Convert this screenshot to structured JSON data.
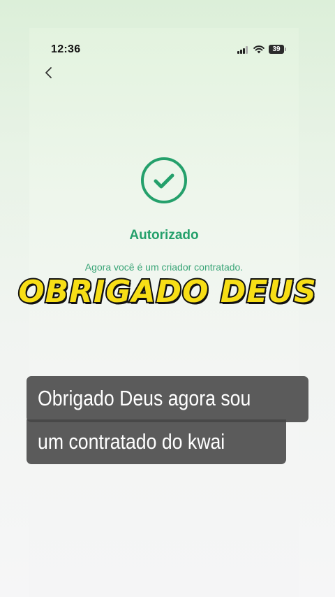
{
  "status_bar": {
    "time": "12:36",
    "battery": "39"
  },
  "icons": {
    "back": "chevron-left-icon",
    "status": "check-circle-icon",
    "signal": "cellular-signal-icon",
    "wifi": "wifi-icon",
    "battery": "battery-icon"
  },
  "result": {
    "title": "Autorizado",
    "message": "Agora você é um criador contratado."
  },
  "overlay": {
    "banner": "OBRIGADO DEUS",
    "caption_lines": [
      "Obrigado Deus agora sou",
      "um contratado do kwai"
    ]
  },
  "colors": {
    "accent": "#24a06b",
    "banner_fill": "#f7de16",
    "caption_bg": "#464646"
  }
}
